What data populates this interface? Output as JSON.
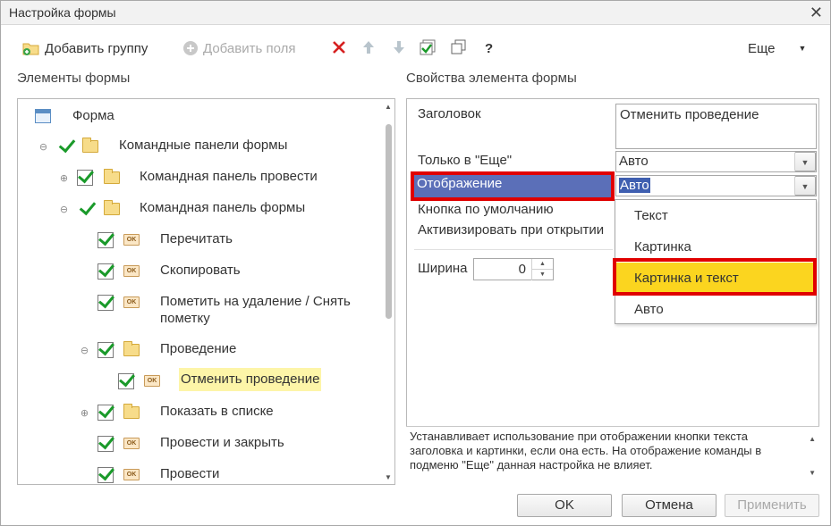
{
  "window": {
    "title": "Настройка формы"
  },
  "toolbar": {
    "add_group": "Добавить группу",
    "add_fields": "Добавить поля",
    "help": "?",
    "more": "Еще"
  },
  "left": {
    "heading": "Элементы формы",
    "tree": [
      {
        "label": "Форма"
      },
      {
        "label": "Командные панели формы"
      },
      {
        "label": "Командная панель провести"
      },
      {
        "label": "Командная панель формы"
      },
      {
        "label": "Перечитать"
      },
      {
        "label": "Скопировать"
      },
      {
        "label": "Пометить на удаление / Снять пометку"
      },
      {
        "label": "Проведение"
      },
      {
        "label": "Отменить проведение"
      },
      {
        "label": "Показать в списке"
      },
      {
        "label": "Провести и закрыть"
      },
      {
        "label": "Провести"
      }
    ]
  },
  "right": {
    "heading": "Свойства элемента формы",
    "caption_label": "Заголовок",
    "caption_value": "Отменить проведение",
    "only_in_more_label": "Только в \"Еще\"",
    "only_in_more_value": "Авто",
    "display_label": "Отображение",
    "display_value": "Авто",
    "default_button_label": "Кнопка по умолчанию",
    "activate_label": "Активизировать при открытии",
    "width_label": "Ширина",
    "width_value": "0",
    "dropdown_options": [
      "Текст",
      "Картинка",
      "Картинка и текст",
      "Авто"
    ],
    "help_text": "Устанавливает использование при отображении кнопки текста заголовка и картинки, если она есть. На отображение команды в подменю \"Еще\" данная настройка не влияет."
  },
  "buttons": {
    "ok": "OK",
    "cancel": "Отмена",
    "apply": "Применить"
  },
  "colors": {
    "selection": "#5b6fb8",
    "highlight_yellow": "#fbd51f",
    "red_frame": "#e00000",
    "check_green": "#1a9a2a"
  }
}
